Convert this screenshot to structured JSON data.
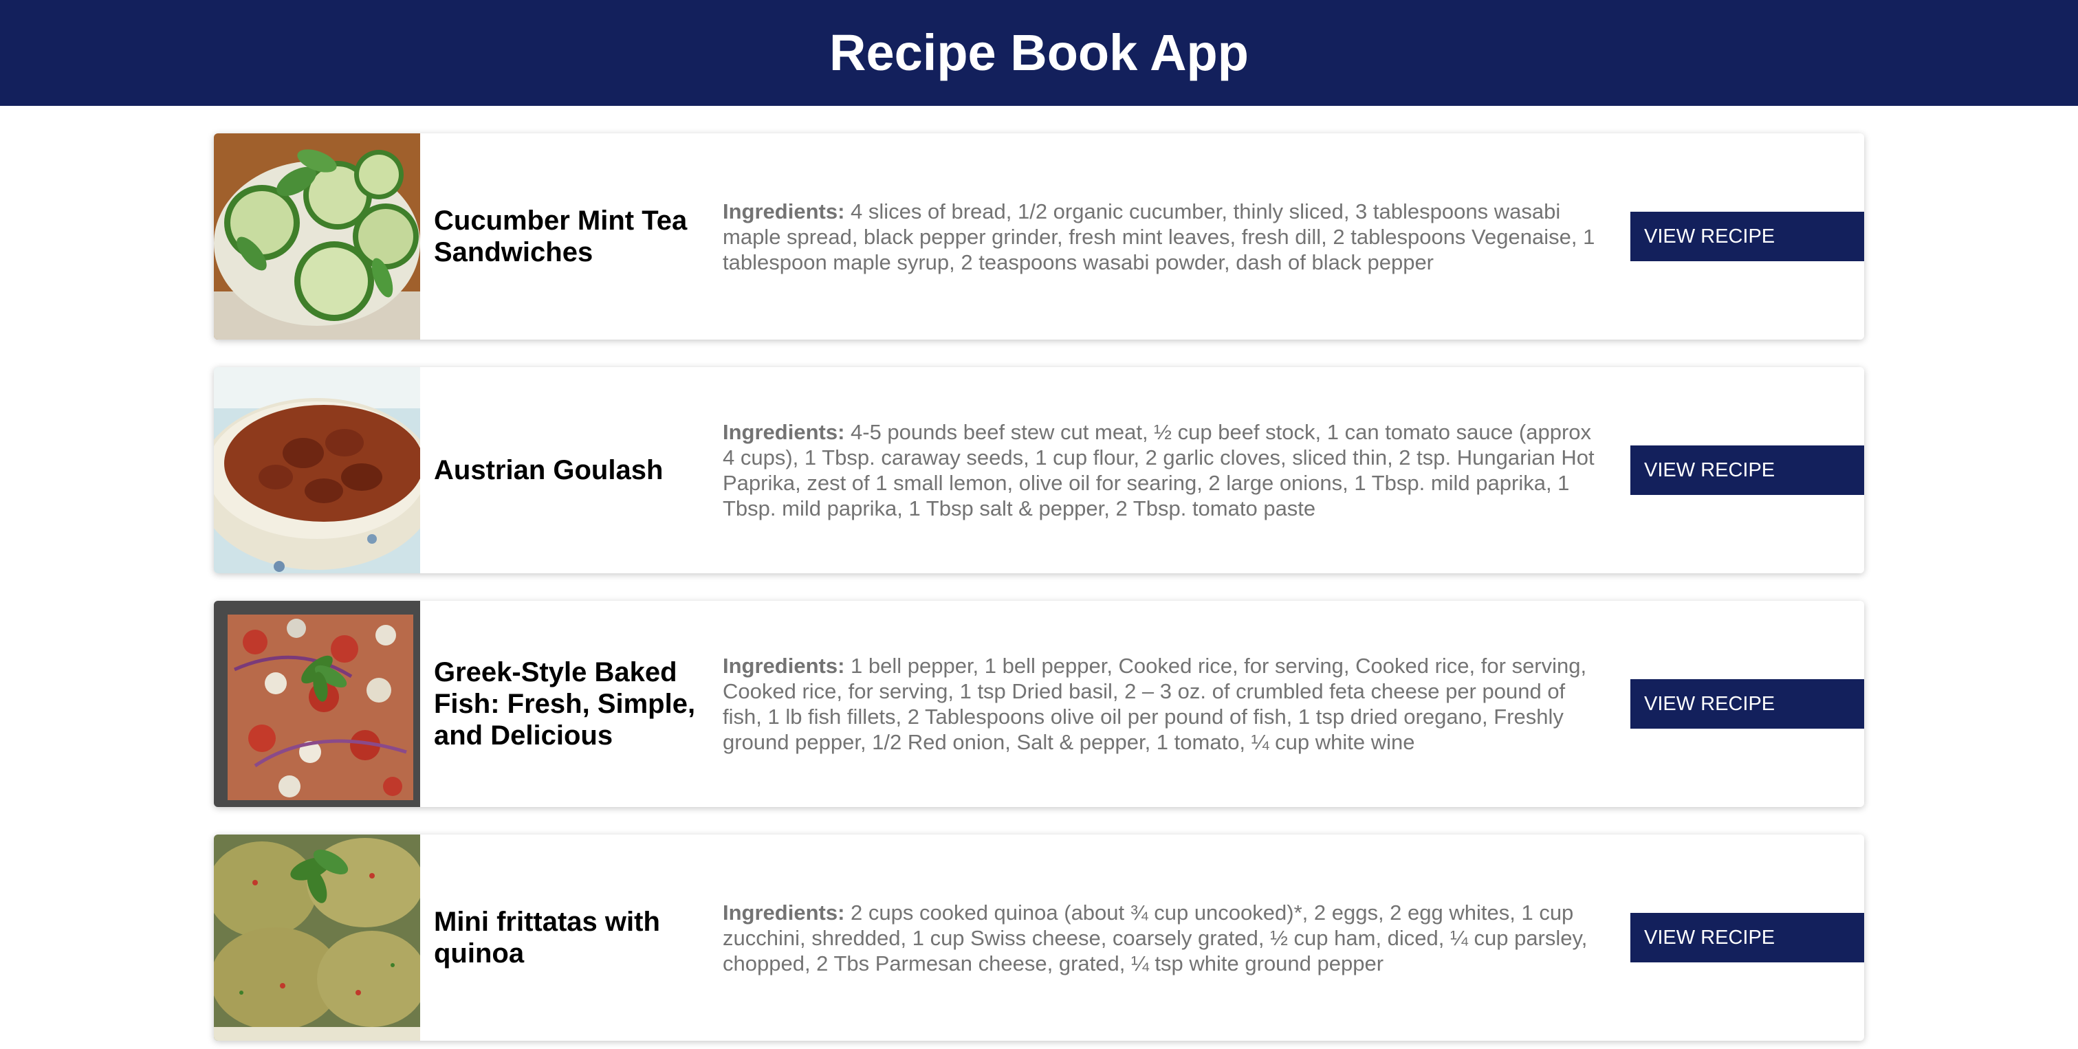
{
  "header": {
    "title": "Recipe Book App"
  },
  "colors": {
    "header_bg": "#13205c",
    "button_bg": "#13205c",
    "ingredients_text": "#737373"
  },
  "recipes": [
    {
      "name": "Cucumber Mint Tea Sandwiches",
      "image_icon": "cucumber-mint-photo",
      "ingredients_label": "Ingredients:",
      "ingredients": " 4 slices of bread, 1/2 organic cucumber, thinly sliced, 3 tablespoons wasabi maple spread, black pepper grinder, fresh mint leaves, fresh dill, 2 tablespoons Vegenaise, 1 tablespoon maple syrup, 2 teaspoons wasabi powder, dash of black pepper",
      "button_label": "VIEW RECIPE"
    },
    {
      "name": "Austrian Goulash",
      "image_icon": "goulash-bowl-photo",
      "ingredients_label": "Ingredients:",
      "ingredients": " 4-5 pounds beef stew cut meat, ½ cup beef stock, 1 can tomato sauce (approx 4 cups), 1 Tbsp. caraway seeds, 1 cup flour, 2 garlic cloves, sliced thin, 2 tsp. Hungarian Hot Paprika, zest of 1 small lemon, olive oil for searing, 2 large onions, 1 Tbsp. mild paprika, 1 Tbsp. mild paprika, 1 Tbsp salt & pepper, 2 Tbsp. tomato paste",
      "button_label": "VIEW RECIPE"
    },
    {
      "name": "Greek-Style Baked Fish: Fresh, Simple, and Delicious",
      "image_icon": "baked-fish-photo",
      "ingredients_label": "Ingredients:",
      "ingredients": " 1 bell pepper, 1 bell pepper, Cooked rice, for serving, Cooked rice, for serving, Cooked rice, for serving, 1 tsp Dried basil, 2 – 3 oz. of crumbled feta cheese per pound of fish, 1 lb fish fillets, 2 Tablespoons olive oil per pound of fish, 1 tsp dried oregano, Freshly ground pepper, 1/2 Red onion, Salt & pepper, 1 tomato, ¼ cup white wine",
      "button_label": "VIEW RECIPE"
    },
    {
      "name": "Mini frittatas with quinoa",
      "image_icon": "quinoa-frittata-photo",
      "ingredients_label": "Ingredients:",
      "ingredients": " 2 cups cooked quinoa (about ¾ cup uncooked)*, 2 eggs, 2 egg whites, 1 cup zucchini, shredded, 1 cup Swiss cheese, coarsely grated, ½ cup ham, diced, ¼ cup parsley, chopped, 2 Tbs Parmesan cheese, grated, ¼ tsp white ground pepper",
      "button_label": "VIEW RECIPE"
    }
  ]
}
